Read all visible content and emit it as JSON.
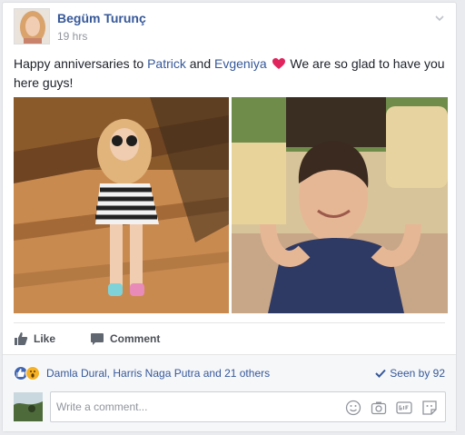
{
  "post": {
    "author": "Begüm Turunç",
    "time": "19 hrs",
    "text_1": "Happy anniversaries to ",
    "mention_1": "Patrick",
    "text_2": " and ",
    "mention_2": "Evgeniya",
    "text_3": " We are so glad to have you here guys!"
  },
  "actions": {
    "like": "Like",
    "comment": "Comment"
  },
  "reactions": {
    "names": "Damla Dural, Harris Naga Putra and 21 others",
    "seen": "Seen by 92"
  },
  "comment": {
    "placeholder": "Write a comment..."
  },
  "colors": {
    "link": "#365899",
    "like_blue": "#4267b2",
    "heart": "#e0245e"
  },
  "icons": [
    "chevron-down-icon",
    "heart-icon",
    "like-icon",
    "comment-icon",
    "wow-reaction-icon",
    "checkmark-icon",
    "emoji-icon",
    "camera-icon",
    "gif-icon",
    "sticker-icon"
  ]
}
